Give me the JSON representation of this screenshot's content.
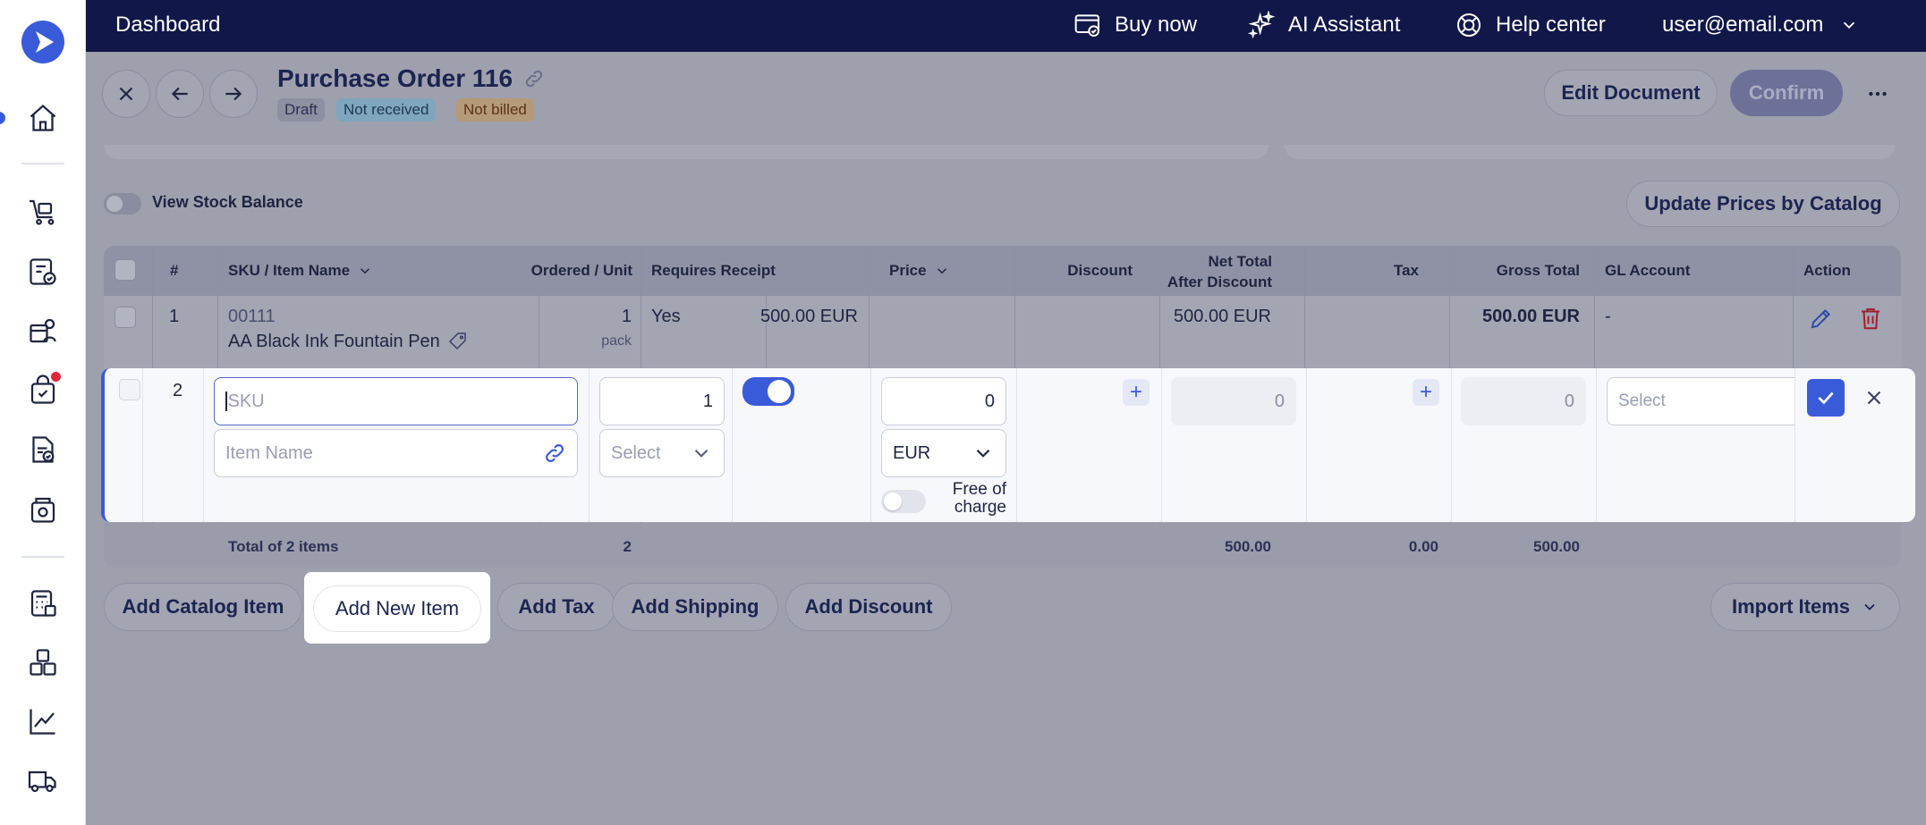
{
  "topbar": {
    "title": "Dashboard",
    "buy_now": "Buy now",
    "ai_assistant": "AI Assistant",
    "help_center": "Help center",
    "user": "user@email.com"
  },
  "header": {
    "title": "Purchase Order 116",
    "badges": [
      "Draft",
      "Not received",
      "Not billed"
    ],
    "edit_document": "Edit Document",
    "confirm": "Confirm"
  },
  "toolbar": {
    "view_stock_balance": "View Stock Balance",
    "update_prices": "Update Prices by Catalog"
  },
  "table": {
    "columns": {
      "num": "#",
      "sku": "SKU / Item Name",
      "ordered": "Ordered / Unit",
      "requires_receipt": "Requires Receipt",
      "price": "Price",
      "discount": "Discount",
      "net_total_1": "Net Total",
      "net_total_2": "After Discount",
      "tax": "Tax",
      "gross_total": "Gross Total",
      "gl_account": "GL Account",
      "action": "Action"
    },
    "rows": [
      {
        "num": "1",
        "sku": "00111",
        "name": "AA Black Ink Fountain Pen",
        "qty": "1",
        "unit": "pack",
        "requires_receipt": "Yes",
        "price": "500.00 EUR",
        "net_total": "500.00 EUR",
        "gross_total": "500.00 EUR",
        "gl_account": "-"
      }
    ],
    "edit_row": {
      "num": "2",
      "sku_placeholder": "SKU",
      "name_placeholder": "Item Name",
      "qty": "1",
      "unit_placeholder": "Select",
      "price": "0",
      "currency": "EUR",
      "free_of_charge_1": "Free of",
      "free_of_charge_2": "charge",
      "net_total": "0",
      "gross_total": "0",
      "gl_placeholder": "Select",
      "requires_receipt": true,
      "free_of_charge": false
    },
    "footer": {
      "label": "Total of 2 items",
      "qty": "2",
      "net_total": "500.00",
      "tax": "0.00",
      "gross_total": "500.00"
    }
  },
  "actions": {
    "add_catalog_item": "Add Catalog Item",
    "add_new_item": "Add New Item",
    "add_tax": "Add Tax",
    "add_shipping": "Add Shipping",
    "add_discount": "Add Discount",
    "import_items": "Import Items"
  },
  "colors": {
    "accent": "#3a5bd9",
    "topbar": "#111849",
    "danger": "#e0263c"
  }
}
